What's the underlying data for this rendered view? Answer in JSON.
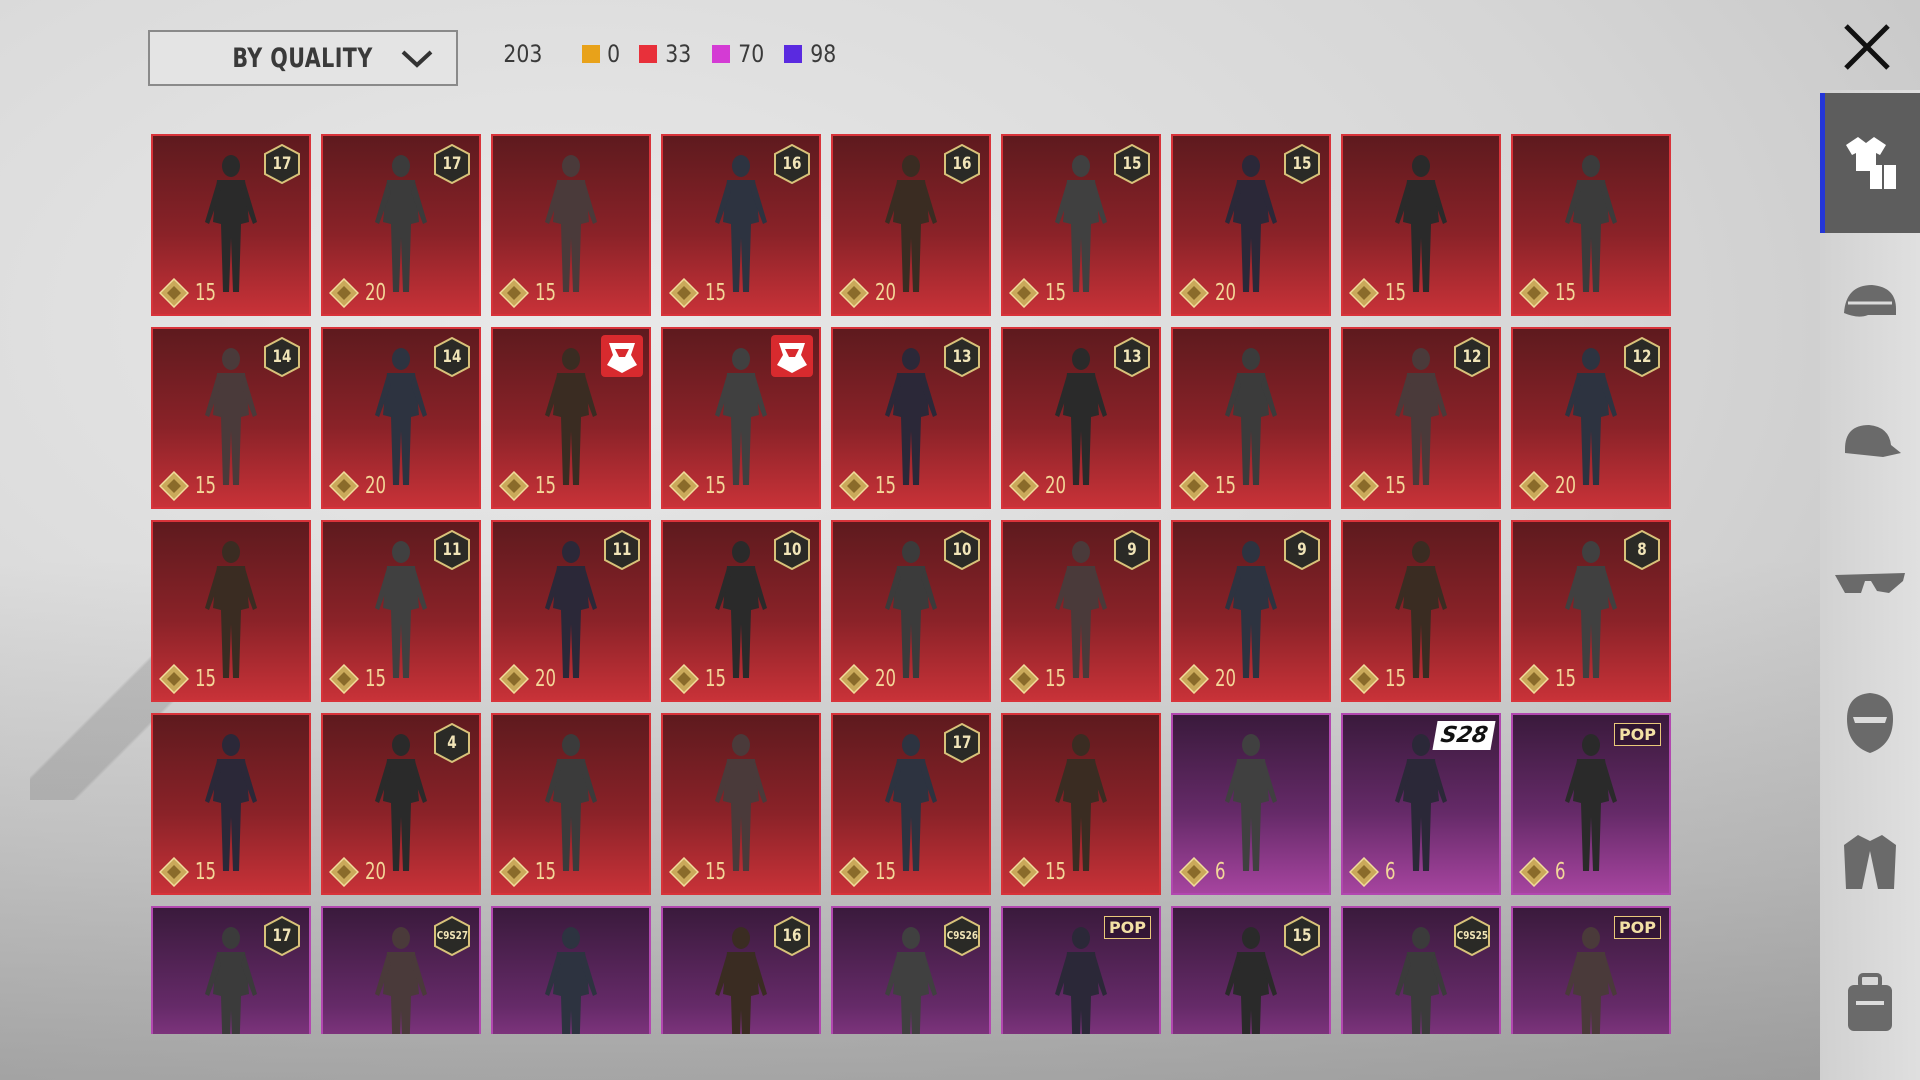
{
  "sort": {
    "label": "BY QUALITY"
  },
  "counts": {
    "total": "203",
    "tiers": [
      {
        "color": "#e8a21a",
        "value": "0"
      },
      {
        "color": "#e8303a",
        "value": "33"
      },
      {
        "color": "#d43bd4",
        "value": "70"
      },
      {
        "color": "#5a2ae0",
        "value": "98"
      }
    ]
  },
  "sidebar": {
    "items": [
      {
        "icon": "outfit-icon",
        "active": true
      },
      {
        "icon": "helmet-icon",
        "active": false
      },
      {
        "icon": "cap-icon",
        "active": false
      },
      {
        "icon": "glasses-icon",
        "active": false
      },
      {
        "icon": "mask-icon",
        "active": false
      },
      {
        "icon": "jacket-icon",
        "active": false
      },
      {
        "icon": "backpack-icon",
        "active": false
      }
    ]
  },
  "items": [
    {
      "rarity": "red",
      "price": "15",
      "badge": "17"
    },
    {
      "rarity": "red",
      "price": "20",
      "badge": "17"
    },
    {
      "rarity": "red",
      "price": "15",
      "badge": ""
    },
    {
      "rarity": "red",
      "price": "15",
      "badge": "16"
    },
    {
      "rarity": "red",
      "price": "20",
      "badge": "16"
    },
    {
      "rarity": "red",
      "price": "15",
      "badge": "15"
    },
    {
      "rarity": "red",
      "price": "20",
      "badge": "15"
    },
    {
      "rarity": "red",
      "price": "15",
      "badge": ""
    },
    {
      "rarity": "red",
      "price": "15",
      "badge": ""
    },
    {
      "rarity": "red",
      "price": "15",
      "badge": "14"
    },
    {
      "rarity": "red",
      "price": "20",
      "badge": "14"
    },
    {
      "rarity": "red",
      "price": "15",
      "badge": "transformers"
    },
    {
      "rarity": "red",
      "price": "15",
      "badge": "transformers"
    },
    {
      "rarity": "red",
      "price": "15",
      "badge": "13"
    },
    {
      "rarity": "red",
      "price": "20",
      "badge": "13"
    },
    {
      "rarity": "red",
      "price": "15",
      "badge": ""
    },
    {
      "rarity": "red",
      "price": "15",
      "badge": "12"
    },
    {
      "rarity": "red",
      "price": "20",
      "badge": "12"
    },
    {
      "rarity": "red",
      "price": "15",
      "badge": ""
    },
    {
      "rarity": "red",
      "price": "15",
      "badge": "11"
    },
    {
      "rarity": "red",
      "price": "20",
      "badge": "11"
    },
    {
      "rarity": "red",
      "price": "15",
      "badge": "10"
    },
    {
      "rarity": "red",
      "price": "20",
      "badge": "10"
    },
    {
      "rarity": "red",
      "price": "15",
      "badge": "9"
    },
    {
      "rarity": "red",
      "price": "20",
      "badge": "9"
    },
    {
      "rarity": "red",
      "price": "15",
      "badge": ""
    },
    {
      "rarity": "red",
      "price": "15",
      "badge": "8"
    },
    {
      "rarity": "red",
      "price": "15",
      "badge": ""
    },
    {
      "rarity": "red",
      "price": "20",
      "badge": "4"
    },
    {
      "rarity": "red",
      "price": "15",
      "badge": ""
    },
    {
      "rarity": "red",
      "price": "15",
      "badge": ""
    },
    {
      "rarity": "red",
      "price": "15",
      "badge": "17"
    },
    {
      "rarity": "red",
      "price": "15",
      "badge": ""
    },
    {
      "rarity": "purple",
      "price": "6",
      "badge": ""
    },
    {
      "rarity": "purple",
      "price": "6",
      "badge": "S28"
    },
    {
      "rarity": "purple",
      "price": "6",
      "badge": "POP"
    },
    {
      "rarity": "purple",
      "price": "",
      "badge": "17"
    },
    {
      "rarity": "purple",
      "price": "",
      "badge": "C9S27"
    },
    {
      "rarity": "purple",
      "price": "",
      "badge": ""
    },
    {
      "rarity": "purple",
      "price": "",
      "badge": "16"
    },
    {
      "rarity": "purple",
      "price": "",
      "badge": "C9S26"
    },
    {
      "rarity": "purple",
      "price": "",
      "badge": "POP"
    },
    {
      "rarity": "purple",
      "price": "",
      "badge": "15"
    },
    {
      "rarity": "purple",
      "price": "",
      "badge": "C9S25"
    },
    {
      "rarity": "purple",
      "price": "",
      "badge": "POP"
    }
  ]
}
